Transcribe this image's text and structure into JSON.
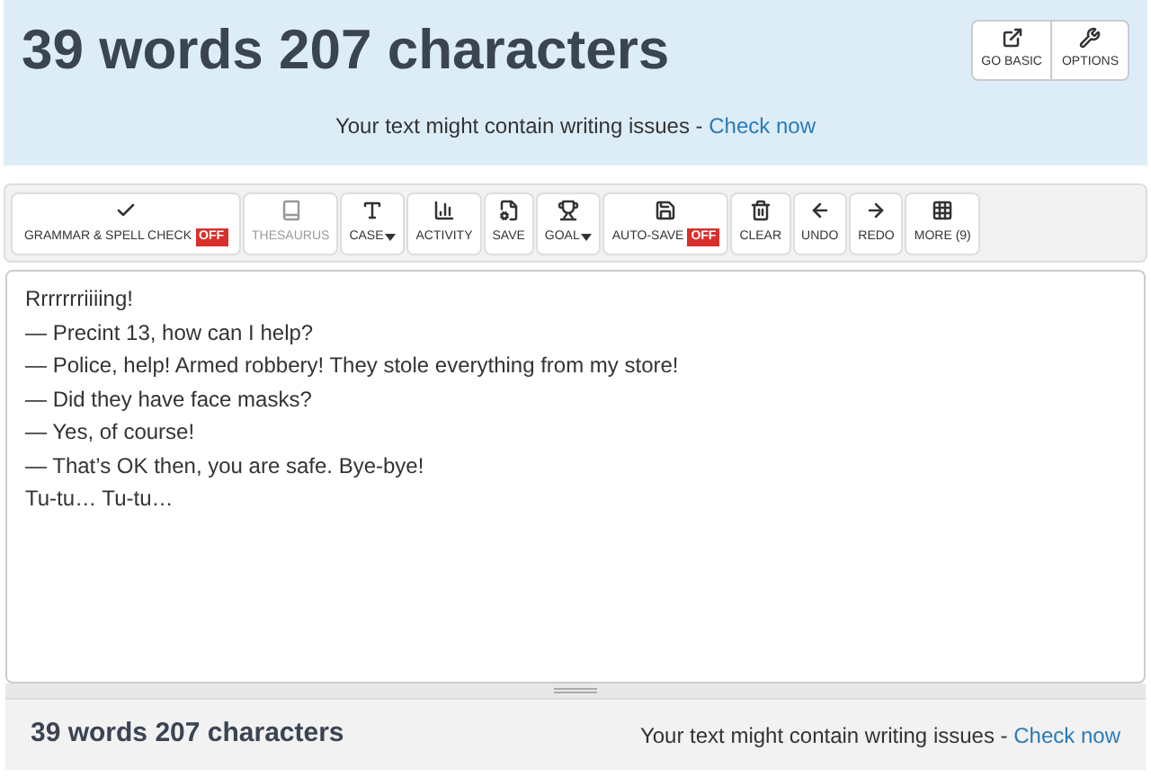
{
  "header": {
    "title": "39 words 207 characters",
    "buttons": [
      {
        "label": "GO BASIC"
      },
      {
        "label": "OPTIONS"
      }
    ],
    "notice": "Your text might contain writing issues - ",
    "notice_link": "Check now"
  },
  "toolbar": [
    {
      "label": "GRAMMAR & SPELL CHECK",
      "badge": "OFF",
      "dropdown": false,
      "disabled": false
    },
    {
      "label": "THESAURUS",
      "dropdown": false,
      "disabled": true
    },
    {
      "label": "CASE",
      "dropdown": true,
      "disabled": false
    },
    {
      "label": "ACTIVITY",
      "dropdown": false,
      "disabled": false
    },
    {
      "label": "SAVE",
      "dropdown": false,
      "disabled": false
    },
    {
      "label": "GOAL",
      "dropdown": true,
      "disabled": false
    },
    {
      "label": "AUTO-SAVE",
      "badge": "OFF",
      "dropdown": false,
      "disabled": false
    },
    {
      "label": "CLEAR",
      "dropdown": false,
      "disabled": false
    },
    {
      "label": "UNDO",
      "dropdown": false,
      "disabled": false
    },
    {
      "label": "REDO",
      "dropdown": false,
      "disabled": false
    },
    {
      "label": "MORE (9)",
      "dropdown": false,
      "disabled": false
    }
  ],
  "editor": {
    "lines": [
      "Rrrrrrriiiing!",
      "— Precint 13, how can I help?",
      "— Police, help! Armed robbery! They stole everything from my store!",
      "— Did they have face masks?",
      "— Yes, of course!",
      "— That’s OK then, you are safe. Bye-bye!",
      "Tu-tu… Tu-tu…"
    ]
  },
  "footer": {
    "counts": "39 words 207 characters",
    "notice": "Your text might contain writing issues - ",
    "notice_link": "Check now"
  }
}
